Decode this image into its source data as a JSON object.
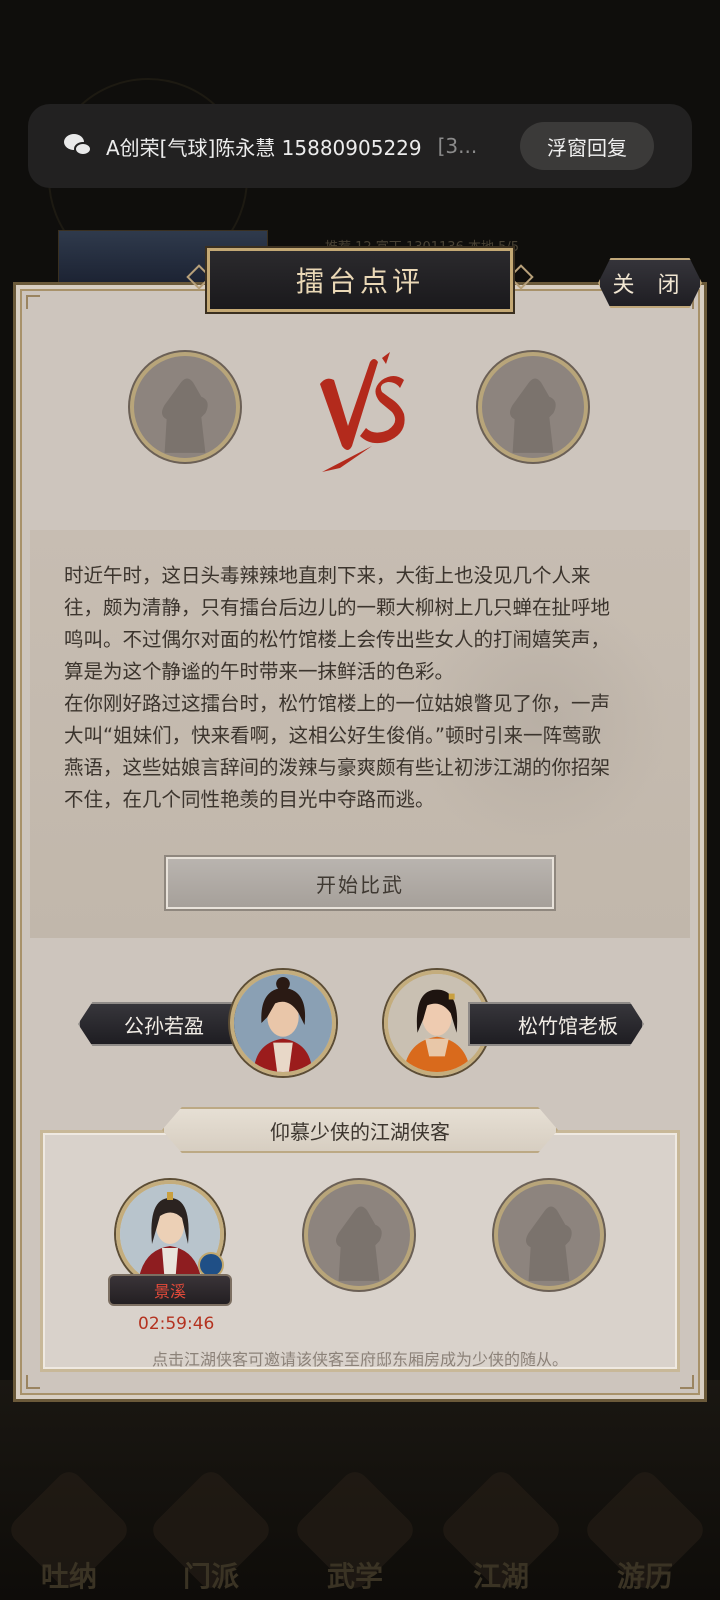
{
  "notification": {
    "app_icon": "wechat-icon",
    "message": "A创荣[气球]陈永慧 15880905229",
    "message_more": "[3...",
    "reply_button": "浮窗回复"
  },
  "background": {
    "stats_text": "推荐 12   富丁 1301136   本地 5/5",
    "nav": [
      "吐纳",
      "门派",
      "武学",
      "江湖",
      "游历"
    ]
  },
  "dialog": {
    "title": "擂台点评",
    "close_label": "关 闭",
    "story_lines": [
      "时近午时，这日头毒辣辣地直刺下来，大街上也没见几个人来",
      "往，颇为清静，只有擂台后边儿的一颗大柳树上几只蝉在扯呼地",
      "鸣叫。不过偶尔对面的松竹馆楼上会传出些女人的打闹嬉笑声，",
      "算是为这个静谧的午时带来一抹鲜活的色彩。",
      "在你刚好路过这擂台时，松竹馆楼上的一位姑娘瞥见了你，一声",
      "大叫“姐妹们，快来看啊，这相公好生俊俏。”顿时引来一阵莺歌",
      "燕语，这些姑娘言辞间的泼辣与豪爽颇有些让初涉江湖的你招架",
      "不住，在几个同性艳羡的目光中夺路而逃。"
    ],
    "start_button": "开始比武",
    "fighter_left": "公孙若盈",
    "fighter_right": "松竹馆老板",
    "fans_title": "仰慕少侠的江湖侠客",
    "fan_name": "景溪",
    "fan_timer": "02:59:46",
    "hint": "点击江湖侠客可邀请该侠客至府邸东厢房成为少侠的随从。"
  },
  "colors": {
    "accent_gold": "#c4a975",
    "vs_red": "#b32a1c",
    "timer_red": "#b4321f"
  }
}
